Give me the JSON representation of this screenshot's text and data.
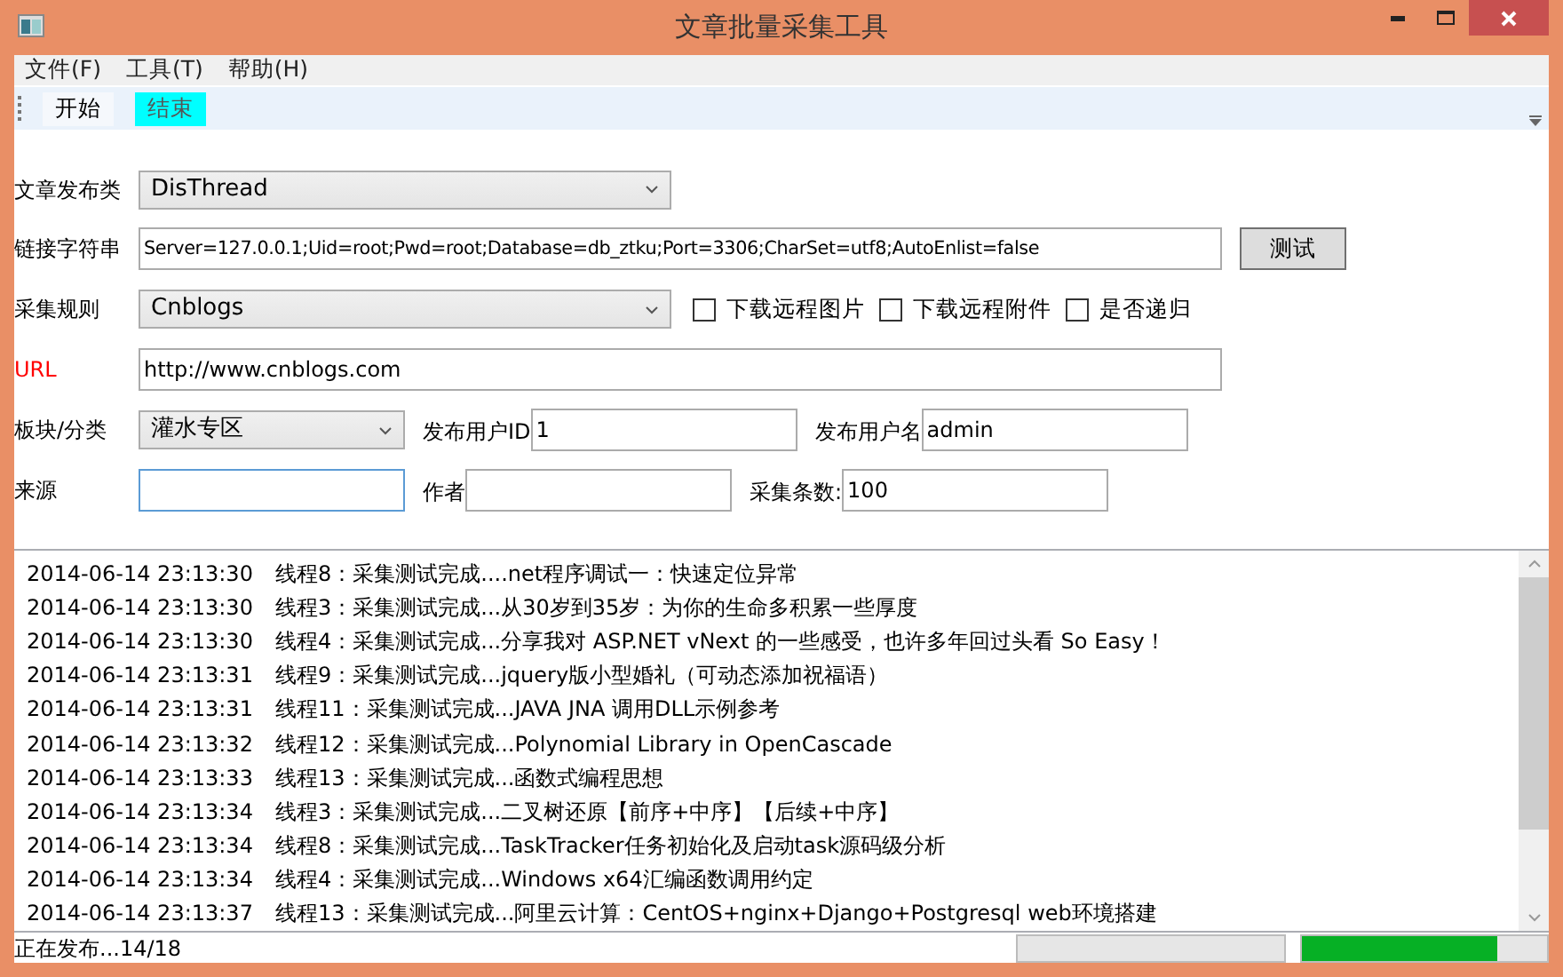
{
  "window": {
    "title": "文章批量采集工具"
  },
  "menu": [
    "文件(F)",
    "工具(T)",
    "帮助(H)"
  ],
  "toolbar": [
    {
      "label": "开始",
      "selected": false
    },
    {
      "label": "结束",
      "selected": true
    }
  ],
  "form": {
    "publish_class": {
      "label": "文章发布类",
      "value": "DisThread"
    },
    "connection": {
      "label": "链接字符串",
      "value": "Server=127.0.0.1;Uid=root;Pwd=root;Database=db_ztku;Port=3306;CharSet=utf8;AutoEnlist=false",
      "button": "测试"
    },
    "rule": {
      "label": "采集规则",
      "value": "Cnblogs"
    },
    "options": [
      {
        "label": "下载远程图片",
        "checked": false
      },
      {
        "label": "下载远程附件",
        "checked": false
      },
      {
        "label": "是否递归",
        "checked": false
      }
    ],
    "url": {
      "label": "URL",
      "value": "http://www.cnblogs.com"
    },
    "category": {
      "label": "板块/分类",
      "value": "灌水专区"
    },
    "user_id": {
      "label": "发布用户ID",
      "value": "1"
    },
    "user_name": {
      "label": "发布用户名",
      "value": "admin"
    },
    "source": {
      "label": "来源"
    },
    "author": {
      "label": "作者"
    },
    "count": {
      "label": "采集条数:",
      "value": "100"
    }
  },
  "log": [
    {
      "time": "2014-06-14 23:13:30",
      "message": "线程8：采集测试完成....net程序调试一：快速定位异常"
    },
    {
      "time": "2014-06-14 23:13:30",
      "message": "线程3：采集测试完成...从30岁到35岁：为你的生命多积累一些厚度"
    },
    {
      "time": "2014-06-14 23:13:30",
      "message": "线程4：采集测试完成...分享我对 ASP.NET vNext 的一些感受，也许多年回过头看 So Easy！"
    },
    {
      "time": "2014-06-14 23:13:31",
      "message": "线程9：采集测试完成...jquery版小型婚礼（可动态添加祝福语）"
    },
    {
      "time": "2014-06-14 23:13:31",
      "message": "线程11：采集测试完成...JAVA JNA 调用DLL示例参考"
    },
    {
      "time": "2014-06-14 23:13:32",
      "message": "线程12：采集测试完成...Polynomial Library in OpenCascade"
    },
    {
      "time": "2014-06-14 23:13:33",
      "message": "线程13：采集测试完成...函数式编程思想"
    },
    {
      "time": "2014-06-14 23:13:34",
      "message": "线程3：采集测试完成...二叉树还原【前序+中序】【后续+中序】"
    },
    {
      "time": "2014-06-14 23:13:34",
      "message": "线程8：采集测试完成...TaskTracker任务初始化及启动task源码级分析"
    },
    {
      "time": "2014-06-14 23:13:34",
      "message": "线程4：采集测试完成...Windows x64汇编函数调用约定"
    },
    {
      "time": "2014-06-14 23:13:37",
      "message": "线程13：采集测试完成...阿里云计算：CentOS+nginx+Django+Postgresql web环境搭建"
    }
  ],
  "status_bar": {
    "text": "正在发布...14/18",
    "progress": {
      "level": 0.8
    }
  }
}
